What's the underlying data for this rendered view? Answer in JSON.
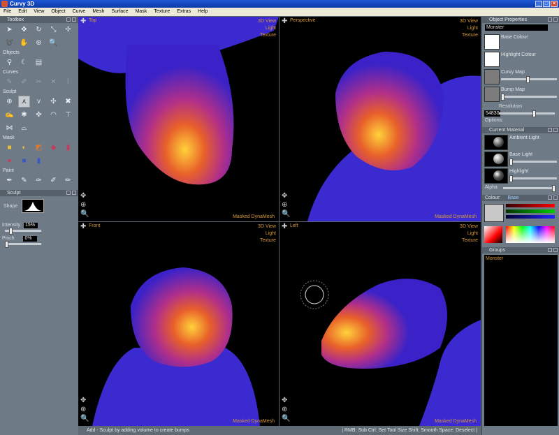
{
  "window": {
    "title": "Curvy 3D"
  },
  "menu": [
    "File",
    "Edit",
    "View",
    "Object",
    "Curve",
    "Mesh",
    "Surface",
    "Mask",
    "Texture",
    "Extras",
    "Help"
  ],
  "toolbox": {
    "title": "Toolbox",
    "sections": {
      "objects": "Objects",
      "curves": "Curves",
      "sculpt": "Sculpt",
      "mask": "Mask",
      "paint": "Paint"
    }
  },
  "sculpt_panel": {
    "title": "Sculpt",
    "shape_label": "Shape",
    "intensity_label": "Intensity",
    "intensity_value": "15%",
    "intensity_level": 0.15,
    "pinch_label": "Pinch",
    "pinch_value": "0%",
    "pinch_level": 0.0
  },
  "viewports": [
    {
      "title": "Top",
      "menu": [
        "3D View",
        "Light",
        "Texture"
      ],
      "corner": ""
    },
    {
      "title": "Perspective",
      "menu": [
        "3D View",
        "Light",
        "Texture"
      ],
      "corner": "Masked DynaMesh"
    },
    {
      "title": "Front",
      "menu": [
        "3D View",
        "Light",
        "Texture"
      ],
      "corner": "Masked DynaMesh"
    },
    {
      "title": "Left",
      "menu": [
        "3D View",
        "Light",
        "Texture"
      ],
      "corner": "Masked DynaMesh"
    }
  ],
  "top_corner": "Masked DynaMesh",
  "status": {
    "left": "Add - Sculpt by adding volume to create bumps",
    "right": "| RMB: Sub  Ctrl: Set Tool Size  Shift: Smooth  Space: Deselect |"
  },
  "object_properties": {
    "title": "Object Properties",
    "name": "Monster",
    "base_colour": "Base Colour",
    "highlight_colour": "Highlight Colour",
    "curvy_map": "Curvy Map",
    "bump_map": "Bump Map",
    "resolution_label": "Resolution",
    "resolution_value": "54830",
    "options": "Options:"
  },
  "current_material": {
    "title": "Current Material",
    "ambient": "Ambient Light",
    "base": "Base Light",
    "highlight": "Highlight",
    "alpha": "Alpha"
  },
  "colour": {
    "label": "Colour:",
    "mode": "Base"
  },
  "groups": {
    "title": "Groups",
    "items": [
      "Monster"
    ]
  },
  "colors": {
    "accent": "#d59a3a",
    "viewport_bg": "#000000",
    "panel": "#6e7b86"
  }
}
